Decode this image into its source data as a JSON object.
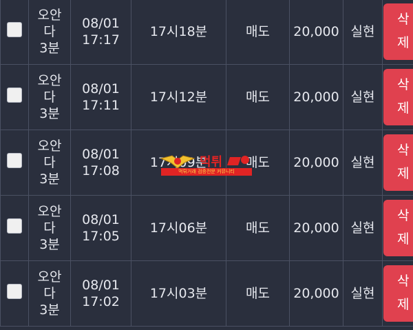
{
  "rows": [
    {
      "game": [
        "오안",
        "다",
        "3분"
      ],
      "date": "08/01",
      "time": "17:17",
      "bet_time": "17시18분",
      "type": "매도",
      "amount": "20,000",
      "result": "실현",
      "delete": [
        "삭",
        "제"
      ]
    },
    {
      "game": [
        "오안",
        "다",
        "3분"
      ],
      "date": "08/01",
      "time": "17:11",
      "bet_time": "17시12분",
      "type": "매도",
      "amount": "20,000",
      "result": "실현",
      "delete": [
        "삭",
        "제"
      ]
    },
    {
      "game": [
        "오안",
        "다",
        "3분"
      ],
      "date": "08/01",
      "time": "17:08",
      "bet_time": "17시09분",
      "type": "매도",
      "amount": "20,000",
      "result": "실현",
      "delete": [
        "삭",
        "제"
      ]
    },
    {
      "game": [
        "오안",
        "다",
        "3분"
      ],
      "date": "08/01",
      "time": "17:05",
      "bet_time": "17시06분",
      "type": "매도",
      "amount": "20,000",
      "result": "실현",
      "delete": [
        "삭",
        "제"
      ]
    },
    {
      "game": [
        "오안",
        "다",
        "3분"
      ],
      "date": "08/01",
      "time": "17:02",
      "bet_time": "17시03분",
      "type": "매도",
      "amount": "20,000",
      "result": "실현",
      "delete": [
        "삭",
        "제"
      ]
    }
  ],
  "watermark": {
    "brand": "먹튀",
    "tagline": "먹튀거래 검증전문 커뮤니티"
  },
  "colors": {
    "background": "#2a2f3d",
    "border": "#4b5163",
    "result_green": "#5fbf62",
    "delete_red": "#e0414f"
  }
}
